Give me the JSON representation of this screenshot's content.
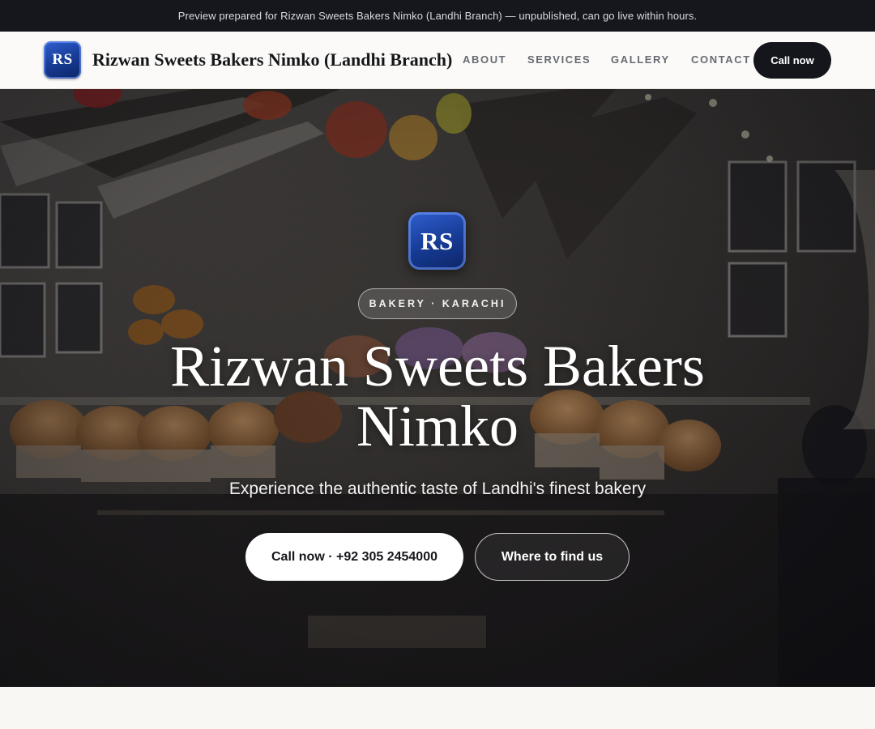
{
  "preview_bar": {
    "text": "Preview prepared for Rizwan Sweets Bakers Nimko (Landhi Branch) — unpublished, can go live within hours."
  },
  "header": {
    "logo_initials": "RS",
    "brand_name": "Rizwan Sweets Bakers Nimko (Landhi Branch)",
    "nav": [
      {
        "label": "ABOUT"
      },
      {
        "label": "SERVICES"
      },
      {
        "label": "GALLERY"
      },
      {
        "label": "CONTACT"
      }
    ],
    "cta_label": "Call now"
  },
  "hero": {
    "logo_initials": "RS",
    "badge": "BAKERY · KARACHI",
    "title": "Rizwan Sweets Bakers Nimko",
    "subtitle": "Experience the authentic taste of Landhi's finest bakery",
    "primary_button": "Call now · +92 305 2454000",
    "secondary_button": "Where to find us",
    "background_image": "bakery-display-photo"
  },
  "colors": {
    "preview_bar_bg": "#15171c",
    "header_bg": "#fbfaf8",
    "cta_dark": "#14161b",
    "logo_blue": "#163a92",
    "page_bg": "#f8f7f4"
  }
}
